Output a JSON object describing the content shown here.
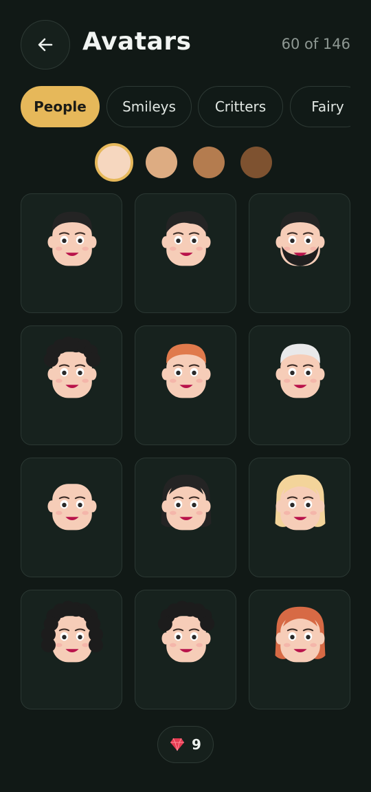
{
  "header": {
    "title": "Avatars",
    "counter": "60 of 146"
  },
  "tabs": [
    {
      "label": "People",
      "active": true
    },
    {
      "label": "Smileys",
      "active": false
    },
    {
      "label": "Critters",
      "active": false
    },
    {
      "label": "Fairy",
      "active": false
    }
  ],
  "skin_tones": [
    {
      "color": "#f6d7bf",
      "selected": true
    },
    {
      "color": "#ddac82",
      "selected": false
    },
    {
      "color": "#b47c4f",
      "selected": false
    },
    {
      "color": "#7e5230",
      "selected": false
    }
  ],
  "avatars": [
    {
      "icon": "man-black-hair-avatar-icon",
      "hair": "#242424",
      "style": "short"
    },
    {
      "icon": "man-wavy-black-hair-avatar-icon",
      "hair": "#242424",
      "style": "wavy"
    },
    {
      "icon": "man-black-beard-avatar-icon",
      "hair": "#242424",
      "style": "beard"
    },
    {
      "icon": "man-curly-black-hair-avatar-icon",
      "hair": "#1e1e1e",
      "style": "curly"
    },
    {
      "icon": "man-red-hair-avatar-icon",
      "hair": "#e07a4c",
      "style": "short"
    },
    {
      "icon": "man-white-hair-avatar-icon",
      "hair": "#e9e9ea",
      "style": "short"
    },
    {
      "icon": "bald-man-avatar-icon",
      "hair": "",
      "style": "bald"
    },
    {
      "icon": "woman-black-hair-avatar-icon",
      "hair": "#242424",
      "style": "long"
    },
    {
      "icon": "woman-blonde-hair-avatar-icon",
      "hair": "#f3d49a",
      "style": "long"
    },
    {
      "icon": "woman-curly-black-hair-avatar-icon",
      "hair": "#1c1c1c",
      "style": "curly-long"
    },
    {
      "icon": "person-curly-black-hair-avatar-icon",
      "hair": "#1c1c1c",
      "style": "curly"
    },
    {
      "icon": "woman-red-hair-avatar-icon",
      "hair": "#d76a45",
      "style": "long"
    }
  ],
  "gems": {
    "count": "9",
    "icon": "ruby-gem-icon",
    "color": "#e53b52"
  },
  "colors": {
    "background": "#111916",
    "accent": "#e6b85a",
    "skin": "#f6cdb8"
  }
}
